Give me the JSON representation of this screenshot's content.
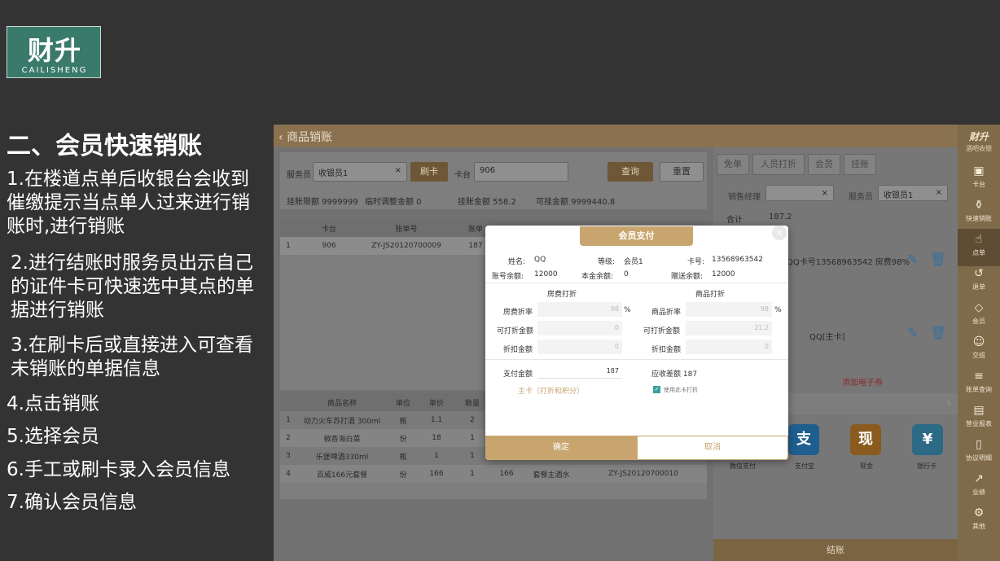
{
  "logo": {
    "main": "财升",
    "sub": "CAILISHENG"
  },
  "slide": {
    "title": "二、会员快速销账",
    "steps": [
      "1.在楼道点单后收银台会收到催缴提示当点单人过来进行销账时,进行销账",
      "2.进行结账时服务员出示自己的证件卡可快速选中其点的单据进行销账",
      "3.在刷卡后或直接进入可查看未销账的单据信息",
      "4.点击销账",
      "5.选择会员",
      "6.手工或刷卡录入会员信息",
      "7.确认会员信息"
    ]
  },
  "app": {
    "header": "商品销账",
    "brand": "财升",
    "brand_sub": "酒吧收银",
    "sidebar": [
      "卡台",
      "快速销账",
      "点单",
      "退单",
      "会员",
      "交班",
      "账单查询",
      "营业报表",
      "协议明细",
      "业绩",
      "其他"
    ],
    "filters": {
      "waiter_label": "服务员",
      "waiter_value": "收银员1",
      "swipe_btn": "刷卡",
      "table_label": "卡台",
      "table_value": "906",
      "query_btn": "查询",
      "reset_btn": "重置",
      "credit_limit": "挂账限额 9999999",
      "temp_adjust": "临时调整金额 0",
      "credit_total": "挂账金额 558.2",
      "credit_available": "可挂金额 9999440.8"
    },
    "bill_table": {
      "headers": [
        "卡台",
        "账单号",
        "账单"
      ],
      "rows": [
        [
          "1",
          "906",
          "ZY-JS20120700009",
          "187"
        ]
      ]
    },
    "item_table": {
      "headers": [
        "商品名称",
        "单位",
        "单价",
        "数量"
      ],
      "rows": [
        [
          "1",
          "动力火车苏打酒 300ml",
          "瓶",
          "1.1",
          "2",
          "",
          "",
          ""
        ],
        [
          "2",
          "椒香海白菜",
          "份",
          "18",
          "1",
          "",
          "",
          ""
        ],
        [
          "3",
          "乐堡啤酒330ml",
          "瓶",
          "1",
          "1",
          "",
          "",
          ""
        ],
        [
          "4",
          "百威166元套餐",
          "份",
          "166",
          "1",
          "166",
          "套餐主酒水",
          "ZY-JS20120700010"
        ]
      ]
    },
    "right_panel": {
      "tabs": [
        "免单",
        "人员打折",
        "会员",
        "挂账"
      ],
      "manager_label": "销售经理",
      "waiter_label": "服务员",
      "waiter_value": "收银员1",
      "total_label": "合计",
      "total_value": "187.2",
      "member_line": "QQ卡号13568963542 房费98%",
      "card_line": "QQ[主卡]",
      "add_coupon": "添加电子券",
      "pay_methods": [
        "微信支付",
        "支付宝",
        "现金",
        "银行卡"
      ],
      "checkout": "结账"
    },
    "modal": {
      "title": "会员支付",
      "name_label": "姓名:",
      "name": "QQ",
      "level_label": "等级:",
      "level": "会员1",
      "card_label": "卡号:",
      "card": "13568963542",
      "balance_label": "账号余额:",
      "balance": "12000",
      "principal_label": "本金余额:",
      "principal": "0",
      "gift_label": "赠送余额:",
      "gift": "12000",
      "room_section": "房费打折",
      "goods_section": "商品打折",
      "room_rate_label": "房费折率",
      "room_rate": "98",
      "goods_rate_label": "商品折率",
      "goods_rate": "98",
      "percent": "%",
      "discountable_label": "可打折金额",
      "room_discountable": "0",
      "goods_discountable": "21.2",
      "discount_label": "折扣金额",
      "room_discount": "0",
      "goods_discount": "0",
      "pay_amount_label": "支付金额",
      "pay_amount": "187",
      "receivable": "应收差额 187",
      "main_card_note": "主卡（打折和积分）",
      "use_card_discount": "使用此卡打折",
      "confirm": "确定",
      "cancel": "取消"
    }
  }
}
